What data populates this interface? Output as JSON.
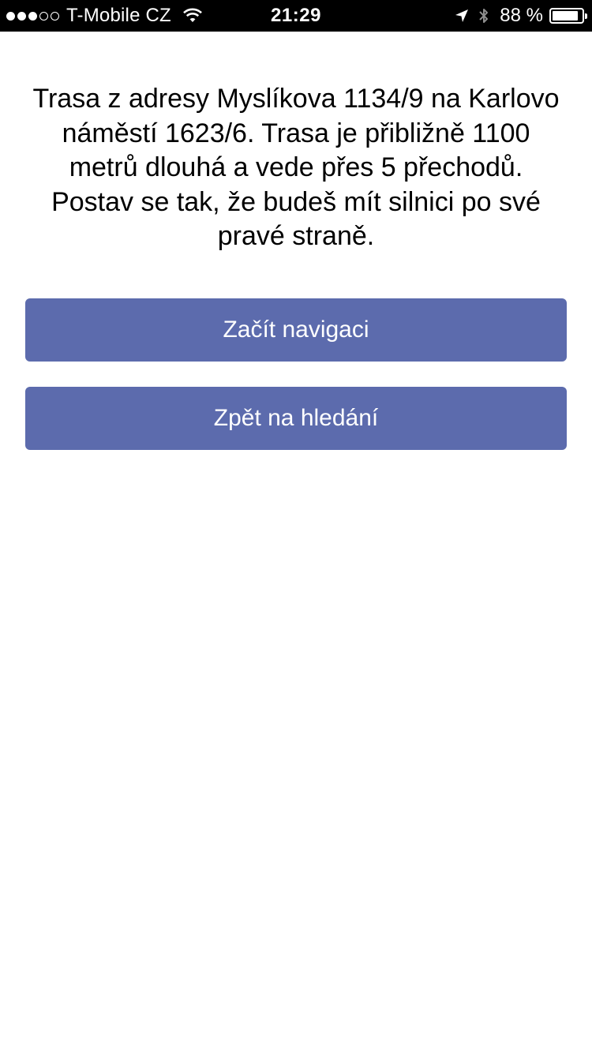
{
  "status_bar": {
    "signal_bars_filled": 3,
    "signal_bars_total": 5,
    "carrier": "T-Mobile CZ",
    "time": "21:29",
    "battery_percent_label": "88 %",
    "battery_level": 0.88,
    "icons": [
      "wifi-icon",
      "location-arrow-icon",
      "bluetooth-icon",
      "battery-icon"
    ]
  },
  "route": {
    "description": "Trasa z adresy Myslíkova 1134/9 na Karlovo náměstí 1623/6. Trasa je přibližně 1100 metrů dlouhá a vede přes 5 přechodů. Postav se tak, že budeš mít silnici po své pravé straně."
  },
  "actions": {
    "start_navigation_label": "Začít navigaci",
    "back_to_search_label": "Zpět na hledání"
  },
  "colors": {
    "button_background": "#5c6bad",
    "button_text": "#ffffff",
    "status_bar_background": "#000000"
  }
}
